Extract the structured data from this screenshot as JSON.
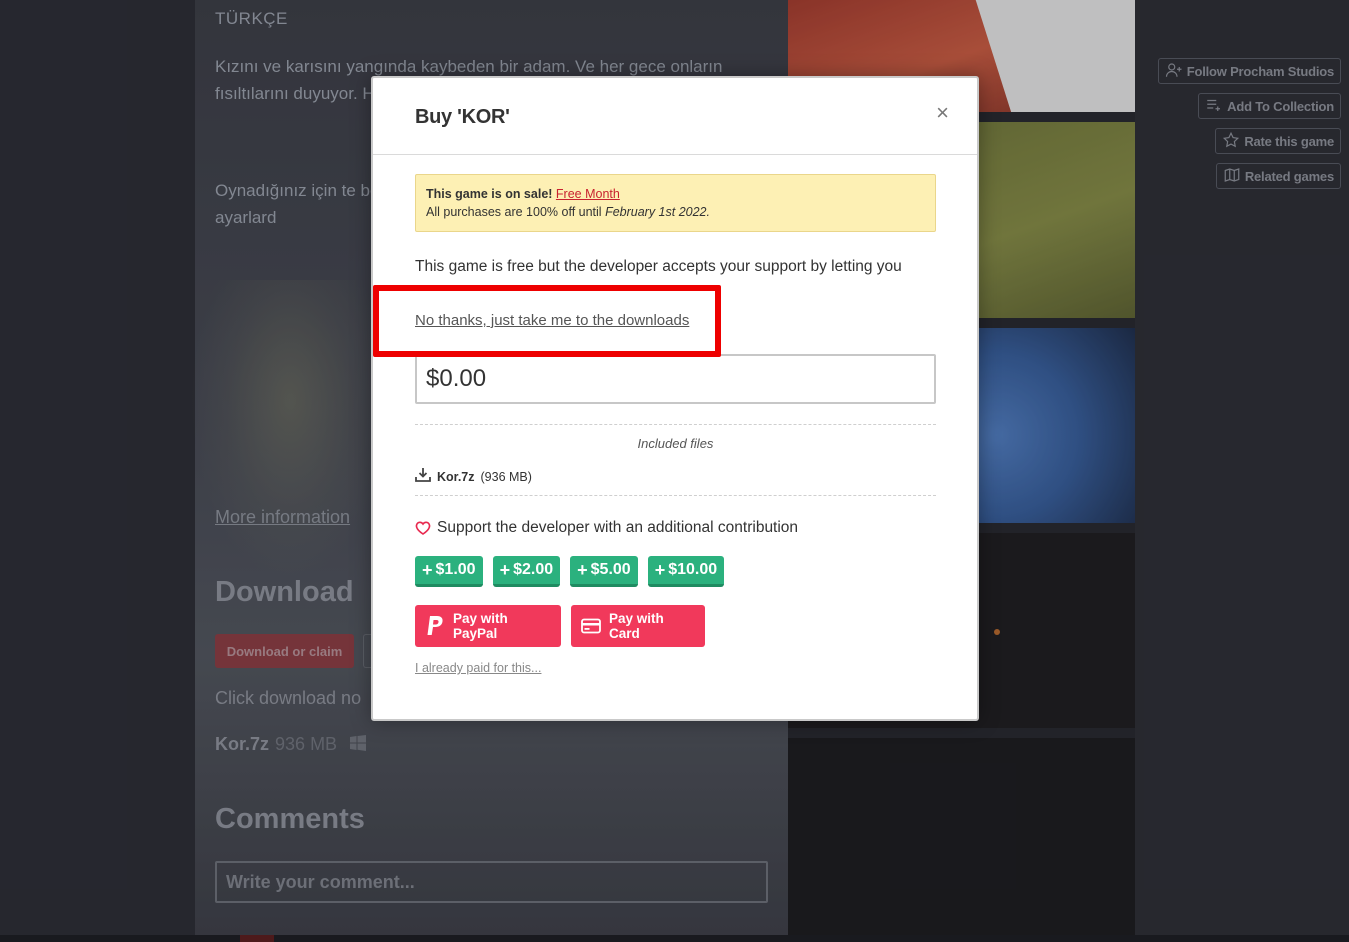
{
  "background": {
    "language_heading": "TÜRKÇE",
    "paragraph1": "Kızını ve karısını yangında kaybeden bir adam. Ve her gece onların fısıltılarını duyuyor. Herkesten saklanıy artık dayanamıyor.",
    "paragraph2": "Oynadığınız için te belirtmek istedim. yapılmıştır. Farklı ç karanlıksa ayarlard",
    "more_info": "More information",
    "download_heading": "Download",
    "download_button": "Download or claim",
    "click_download_text": "Click download no",
    "file_name": "Kor.7z",
    "file_size": "936 MB",
    "comments_heading": "Comments",
    "comment_placeholder": "Write your comment..."
  },
  "sidebar": {
    "follow": "Follow Procham Studios",
    "collection": "Add To Collection",
    "rate": "Rate this game",
    "related": "Related games"
  },
  "modal": {
    "title": "Buy 'KOR'",
    "close_glyph": "×",
    "sale": {
      "heading": "This game is on sale!",
      "link": "Free Month",
      "text_prefix": "All purchases are 100% off until",
      "date": "February 1st 2022."
    },
    "free_description": "This game is free but the developer accepts your support by letting you pay what you think is fair for the game.",
    "no_thanks": "No thanks, just take me to the downloads",
    "amount": "$0.00",
    "included_files_label": "Included files",
    "file": {
      "name": "Kor.7z",
      "size": "(936 MB)"
    },
    "support_text": "Support the developer with an additional contribution",
    "tips": [
      "$1.00",
      "$2.00",
      "$5.00",
      "$10.00"
    ],
    "paypal_label": "Pay with PayPal",
    "card_label": "Pay with Card",
    "already_paid": "I already paid for this..."
  },
  "colors": {
    "accent_red": "#f1395b",
    "tip_green": "#2bb17e",
    "highlight": "#ee0000",
    "sale_bg": "#fdf0b4"
  }
}
